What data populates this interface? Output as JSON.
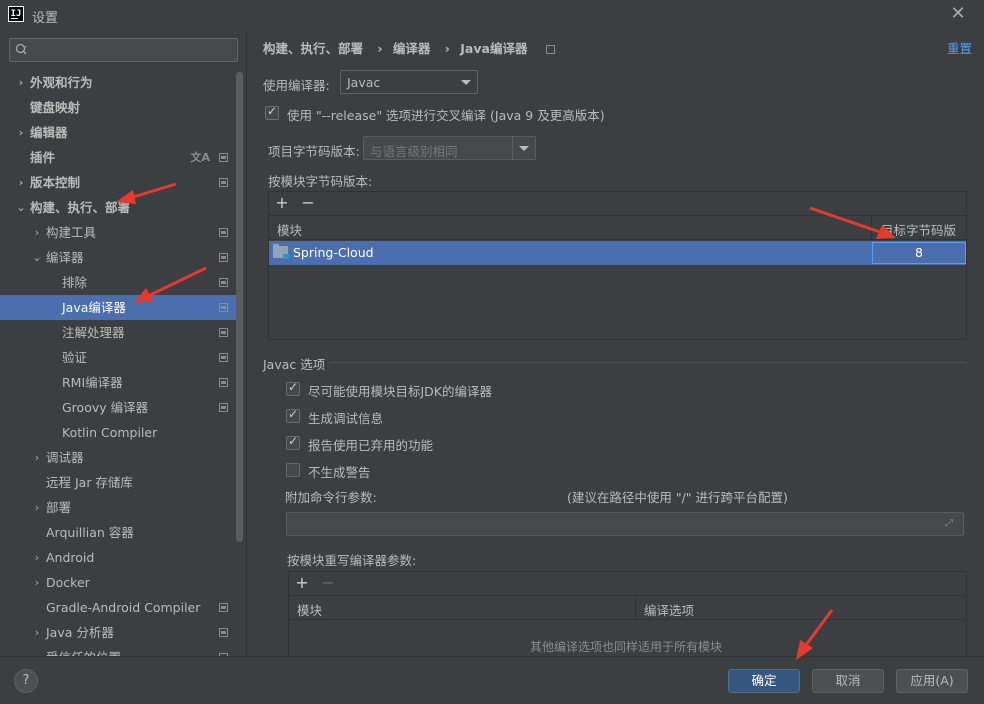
{
  "window": {
    "logo_text": "IJ",
    "title": "设置",
    "close_glyph": "✕"
  },
  "sidebar": {
    "search_placeholder": "",
    "items": [
      {
        "label": "外观和行为",
        "level": 0,
        "arrow": "›",
        "bold": true
      },
      {
        "label": "键盘映射",
        "level": 0,
        "arrow": "",
        "bold": true
      },
      {
        "label": "编辑器",
        "level": 0,
        "arrow": "›",
        "bold": true
      },
      {
        "label": "插件",
        "level": 0,
        "arrow": "",
        "bold": true,
        "lang_icon": "文A"
      },
      {
        "label": "版本控制",
        "level": 0,
        "arrow": "›",
        "bold": true
      },
      {
        "label": "构建、执行、部署",
        "level": 0,
        "arrow": "⌄",
        "bold": true
      },
      {
        "label": "构建工具",
        "level": 1,
        "arrow": "›"
      },
      {
        "label": "编译器",
        "level": 1,
        "arrow": "⌄"
      },
      {
        "label": "排除",
        "level": 2,
        "arrow": ""
      },
      {
        "label": "Java编译器",
        "level": 2,
        "arrow": "",
        "selected": true
      },
      {
        "label": "注解处理器",
        "level": 2,
        "arrow": ""
      },
      {
        "label": "验证",
        "level": 2,
        "arrow": ""
      },
      {
        "label": "RMI编译器",
        "level": 2,
        "arrow": ""
      },
      {
        "label": "Groovy 编译器",
        "level": 2,
        "arrow": ""
      },
      {
        "label": "Kotlin Compiler",
        "level": 2,
        "arrow": ""
      },
      {
        "label": "调试器",
        "level": 1,
        "arrow": "›"
      },
      {
        "label": "远程 Jar 存储库",
        "level": 1,
        "arrow": ""
      },
      {
        "label": "部署",
        "level": 1,
        "arrow": "›"
      },
      {
        "label": "Arquillian 容器",
        "level": 1,
        "arrow": ""
      },
      {
        "label": "Android",
        "level": 1,
        "arrow": "›"
      },
      {
        "label": "Docker",
        "level": 1,
        "arrow": "›"
      },
      {
        "label": "Gradle-Android Compiler",
        "level": 1,
        "arrow": ""
      },
      {
        "label": "Java 分析器",
        "level": 1,
        "arrow": "›"
      },
      {
        "label": "受信任的位置",
        "level": 1,
        "arrow": ""
      }
    ]
  },
  "main": {
    "breadcrumb": [
      "构建、执行、部署",
      "编译器",
      "Java编译器"
    ],
    "breadcrumb_sep": "›",
    "reset_label": "重置",
    "compiler_label": "使用编译器:",
    "compiler_value": "Javac",
    "release_option": "使用 \"--release\" 选项进行交叉编译 (Java 9 及更高版本)",
    "bytecode_label": "项目字节码版本:",
    "bytecode_value": "与语言级别相同",
    "per_module_label": "按模块字节码版本:",
    "add_glyph": "+",
    "remove_glyph": "−",
    "module_table": {
      "col_module": "模块",
      "col_target": "目标字节码版本",
      "rows": [
        {
          "module": "Spring-Cloud",
          "target": "8"
        }
      ]
    },
    "javac_section": "Javac 选项",
    "javac_options": [
      {
        "label": "尽可能使用模块目标JDK的编译器",
        "checked": true
      },
      {
        "label": "生成调试信息",
        "checked": true
      },
      {
        "label": "报告使用已弃用的功能",
        "checked": true
      },
      {
        "label": "不生成警告",
        "checked": false
      }
    ],
    "cmd_params_label": "附加命令行参数:",
    "cmd_params_hint": "(建议在路径中使用 \"/\" 进行跨平台配置)",
    "cmd_params_value": "",
    "expand_glyph": "⤢",
    "override_label": "按模块重写编译器参数:",
    "override_table": {
      "col_module": "模块",
      "col_options": "编译选项",
      "empty_text": "其他编译选项也同样适用于所有模块"
    }
  },
  "footer": {
    "help": "?",
    "ok": "确定",
    "cancel": "取消",
    "apply": "应用(A)"
  },
  "colors": {
    "background": "#3c3f41",
    "selection": "#4b6eaf",
    "link": "#589df6",
    "primary_button": "#365880",
    "annotation_arrow": "#e8392f"
  }
}
